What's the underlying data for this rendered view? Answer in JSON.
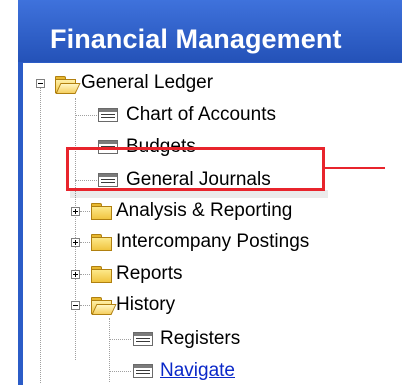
{
  "title": "Financial Management",
  "tree": {
    "general_ledger": "General Ledger",
    "chart_of_accounts": "Chart of Accounts",
    "budgets": "Budgets",
    "general_journals": "General Journals",
    "analysis_reporting": "Analysis & Reporting",
    "intercompany_postings": "Intercompany Postings",
    "reports": "Reports",
    "history": "History",
    "registers": "Registers",
    "navigate": "Navigate"
  },
  "colors": {
    "panel_blue": "#2b5cc7",
    "highlight_red": "#e8242c",
    "link_blue": "#0a28c8"
  }
}
